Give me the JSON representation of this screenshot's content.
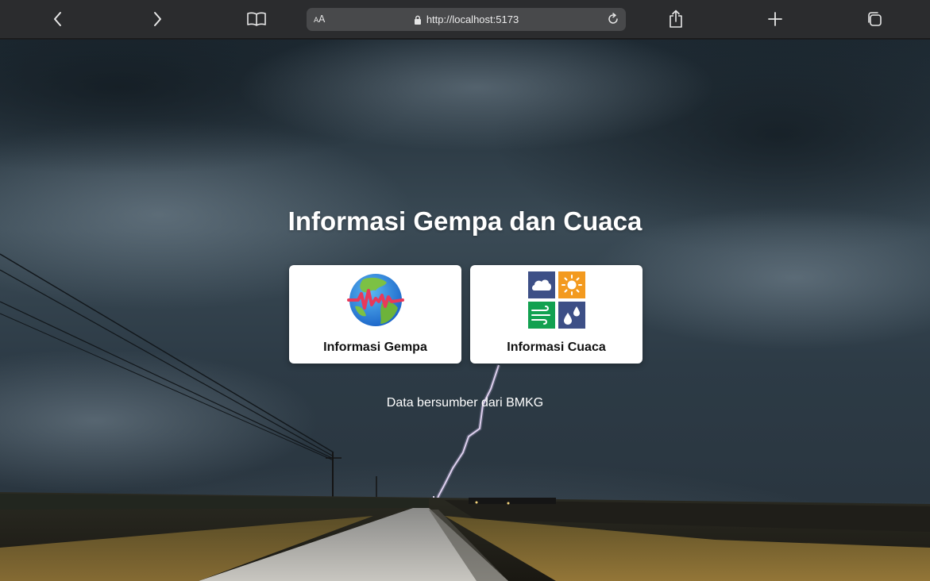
{
  "browser": {
    "text_size_label": "AA",
    "url": "http://localhost:5173"
  },
  "page": {
    "title": "Informasi Gempa dan Cuaca",
    "cards": [
      {
        "label": "Informasi Gempa",
        "icon": "earth-seismic-icon"
      },
      {
        "label": "Informasi Cuaca",
        "icon": "weather-grid-icon"
      }
    ],
    "source_text": "Data bersumber dari BMKG"
  },
  "colors": {
    "toolbar_bg": "#2b2c2e",
    "address_bg": "#48494b",
    "card_bg": "#ffffff",
    "weather_blue": "#3d4f86",
    "weather_orange": "#f39a1f",
    "weather_green": "#12a150"
  }
}
